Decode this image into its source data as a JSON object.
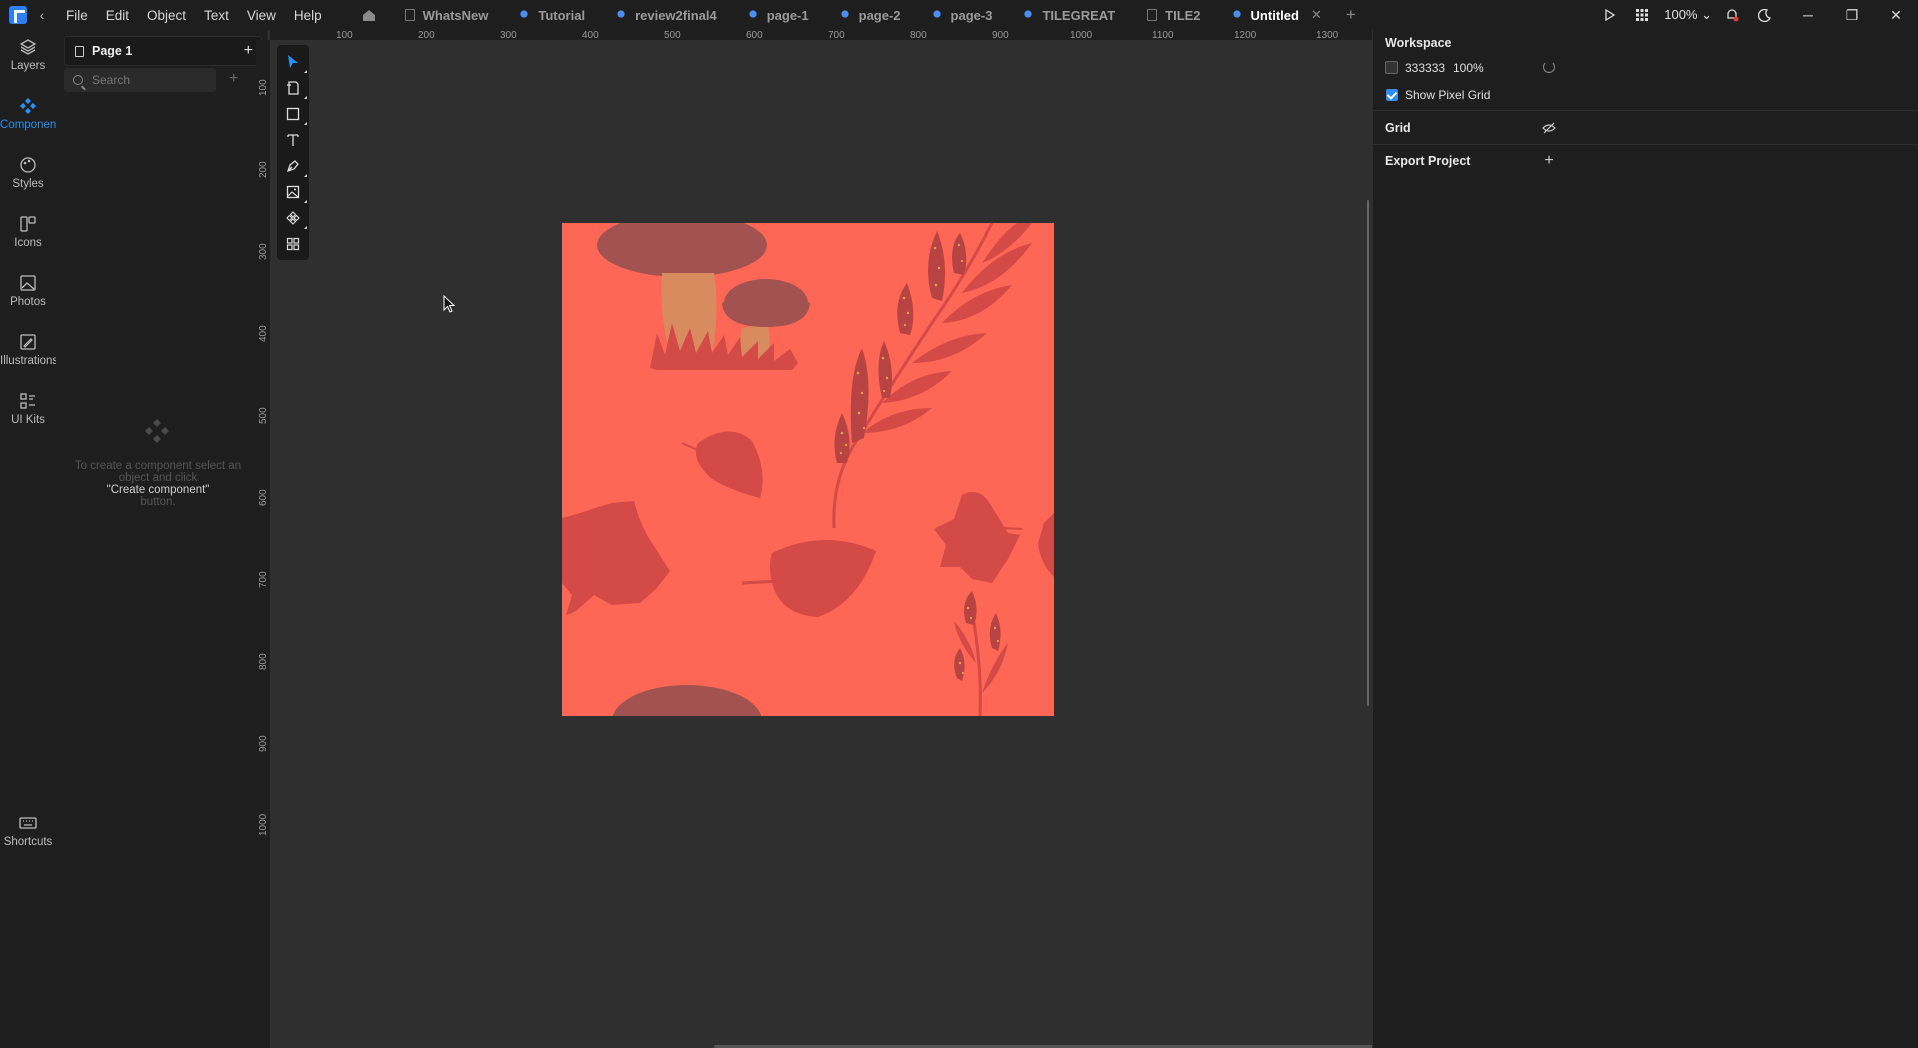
{
  "menu": [
    "File",
    "Edit",
    "Object",
    "Text",
    "View",
    "Help"
  ],
  "tabs": [
    {
      "label": "WhatsNew",
      "icon": "file-icon"
    },
    {
      "label": "Tutorial",
      "icon": "shared-file-icon"
    },
    {
      "label": "review2final4",
      "icon": "shared-file-icon"
    },
    {
      "label": "page-1",
      "icon": "shared-file-icon"
    },
    {
      "label": "page-2",
      "icon": "shared-file-icon"
    },
    {
      "label": "page-3",
      "icon": "shared-file-icon"
    },
    {
      "label": "TILEGREAT",
      "icon": "shared-file-icon"
    },
    {
      "label": "TILE2",
      "icon": "file-icon"
    },
    {
      "label": "Untitled",
      "icon": "shared-file-icon",
      "active": true
    }
  ],
  "titlebar": {
    "zoom": "100%"
  },
  "rail": [
    {
      "label": "Layers",
      "icon": "layers-icon"
    },
    {
      "label": "Components",
      "icon": "components-icon",
      "active": true
    },
    {
      "label": "Styles",
      "icon": "styles-icon"
    },
    {
      "label": "Icons",
      "icon": "icons-icon"
    },
    {
      "label": "Photos",
      "icon": "photos-icon"
    },
    {
      "label": "Illustrations",
      "icon": "illustrations-icon"
    },
    {
      "label": "UI Kits",
      "icon": "ui-kits-icon"
    },
    {
      "label": "Shortcuts",
      "icon": "keyboard-icon"
    }
  ],
  "leftpanel": {
    "page": "Page 1",
    "search_placeholder": "Search",
    "empty_line1": "To create a component select an",
    "empty_line2": "object and click",
    "empty_line3": "\"Create component\"",
    "empty_line4": "button."
  },
  "ruler": {
    "h": [
      "100",
      "200",
      "300",
      "400",
      "500",
      "600",
      "700",
      "800",
      "900",
      "1000",
      "1100",
      "1200",
      "1300"
    ],
    "v": [
      "100",
      "200",
      "300",
      "400",
      "500",
      "600",
      "700",
      "800",
      "900",
      "1000"
    ]
  },
  "artboard": {
    "background": "#fe6655",
    "shape_color": "#d44a46"
  },
  "rightpanel": {
    "workspace_title": "Workspace",
    "workspace_color": "333333",
    "workspace_opacity": "100%",
    "show_pixel_grid": "Show Pixel Grid",
    "grid_title": "Grid",
    "export_title": "Export Project"
  }
}
